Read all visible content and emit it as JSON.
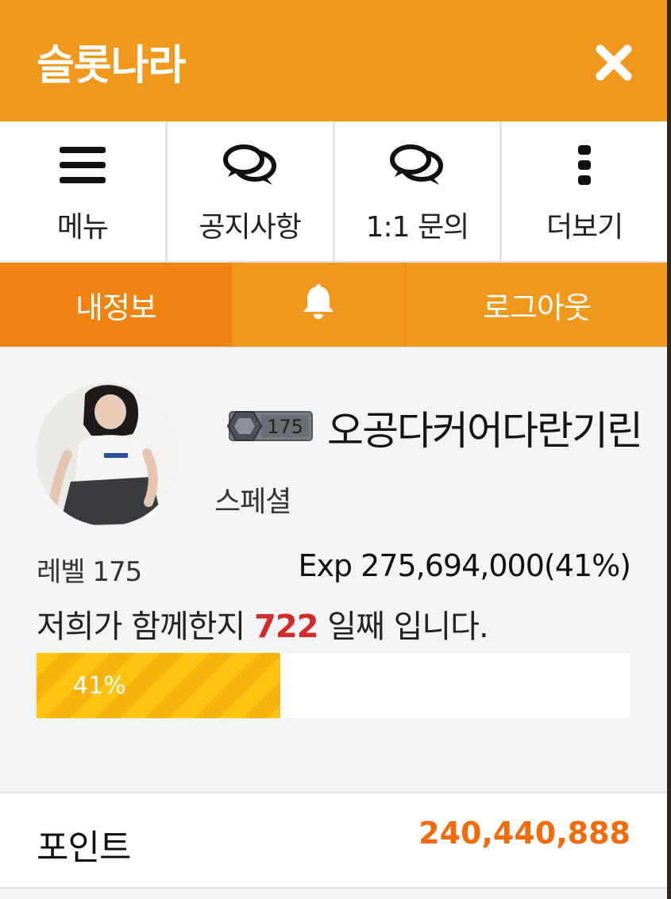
{
  "header": {
    "title": "슬롯나라",
    "close_icon": "close-icon"
  },
  "quick_menu": [
    {
      "label": "메뉴",
      "icon": "hamburger-icon"
    },
    {
      "label": "공지사항",
      "icon": "chat-bubbles-icon"
    },
    {
      "label": "1:1 문의",
      "icon": "chat-bubbles-icon"
    },
    {
      "label": "더보기",
      "icon": "vertical-dots-icon"
    }
  ],
  "tabs": {
    "my_info": "내정보",
    "bell_icon": "bell-icon",
    "logout": "로그아웃"
  },
  "profile": {
    "level_badge": "175",
    "nickname": "오공다커어다란기린",
    "grade": "스페셜",
    "level_text": "레벨 175",
    "exp_text": "Exp 275,694,000(41%)",
    "days_prefix": "저희가 함께한지",
    "days_count": "722",
    "days_suffix": "일째 입니다.",
    "progress_label": "41%",
    "progress_value": 0.41
  },
  "points": {
    "label": "포인트",
    "value": "240,440,888"
  },
  "colors": {
    "brand": "#f0981c",
    "active_tab": "#ef8510",
    "points_value": "#f26a0a",
    "days_highlight": "#d42a2a",
    "progress": "#ffc312"
  }
}
